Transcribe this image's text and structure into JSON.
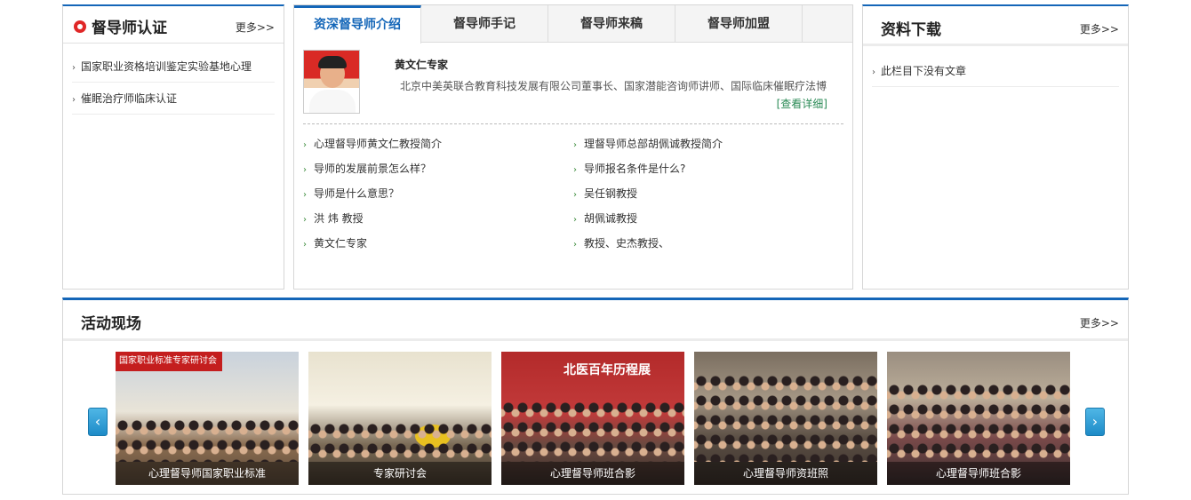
{
  "left": {
    "title": "督导师认证",
    "more": "更多>>",
    "items": [
      "国家职业资格培训鉴定实验基地心理",
      "催眠治疗师临床认证"
    ]
  },
  "middle": {
    "tabs": [
      "资深督导师介绍",
      "督导师手记",
      "督导师来稿",
      "督导师加盟"
    ],
    "featured": {
      "name": "黄文仁专家",
      "desc": "北京中美英联合教育科技发展有限公司董事长、国家潜能咨询师讲师、国际临床催眠疗法博",
      "detail": "[查看详细]"
    },
    "articles": [
      "心理督导师黄文仁教授简介",
      "理督导师总部胡佩诚教授简介",
      "导师的发展前景怎么样？",
      "导师报名条件是什么?",
      "导师是什么意思？",
      "吴任钢教授",
      "洪 炜 教授",
      "胡佩诚教授",
      "黄文仁专家",
      "教授、史杰教授、"
    ]
  },
  "right": {
    "title": "资料下载",
    "more": "更多>>",
    "items": [
      "此栏目下没有文章"
    ]
  },
  "bottom": {
    "title": "活动现场",
    "more": "更多>>",
    "gallery": [
      {
        "caption": "心理督导师国家职业标准",
        "banner": "国家职业标准专家研讨会"
      },
      {
        "caption": "专家研讨会"
      },
      {
        "caption": "心理督导师班合影",
        "banner": "北医百年历程展"
      },
      {
        "caption": "心理督导师资班照"
      },
      {
        "caption": "心理督导师班合影"
      }
    ],
    "prev_icon": "‹",
    "next_icon": "›"
  },
  "colors": {
    "accent": "#1466b8",
    "badge": "#e02727",
    "detail_link": "#2a8a55",
    "nav_button": "#1d8bc7"
  }
}
